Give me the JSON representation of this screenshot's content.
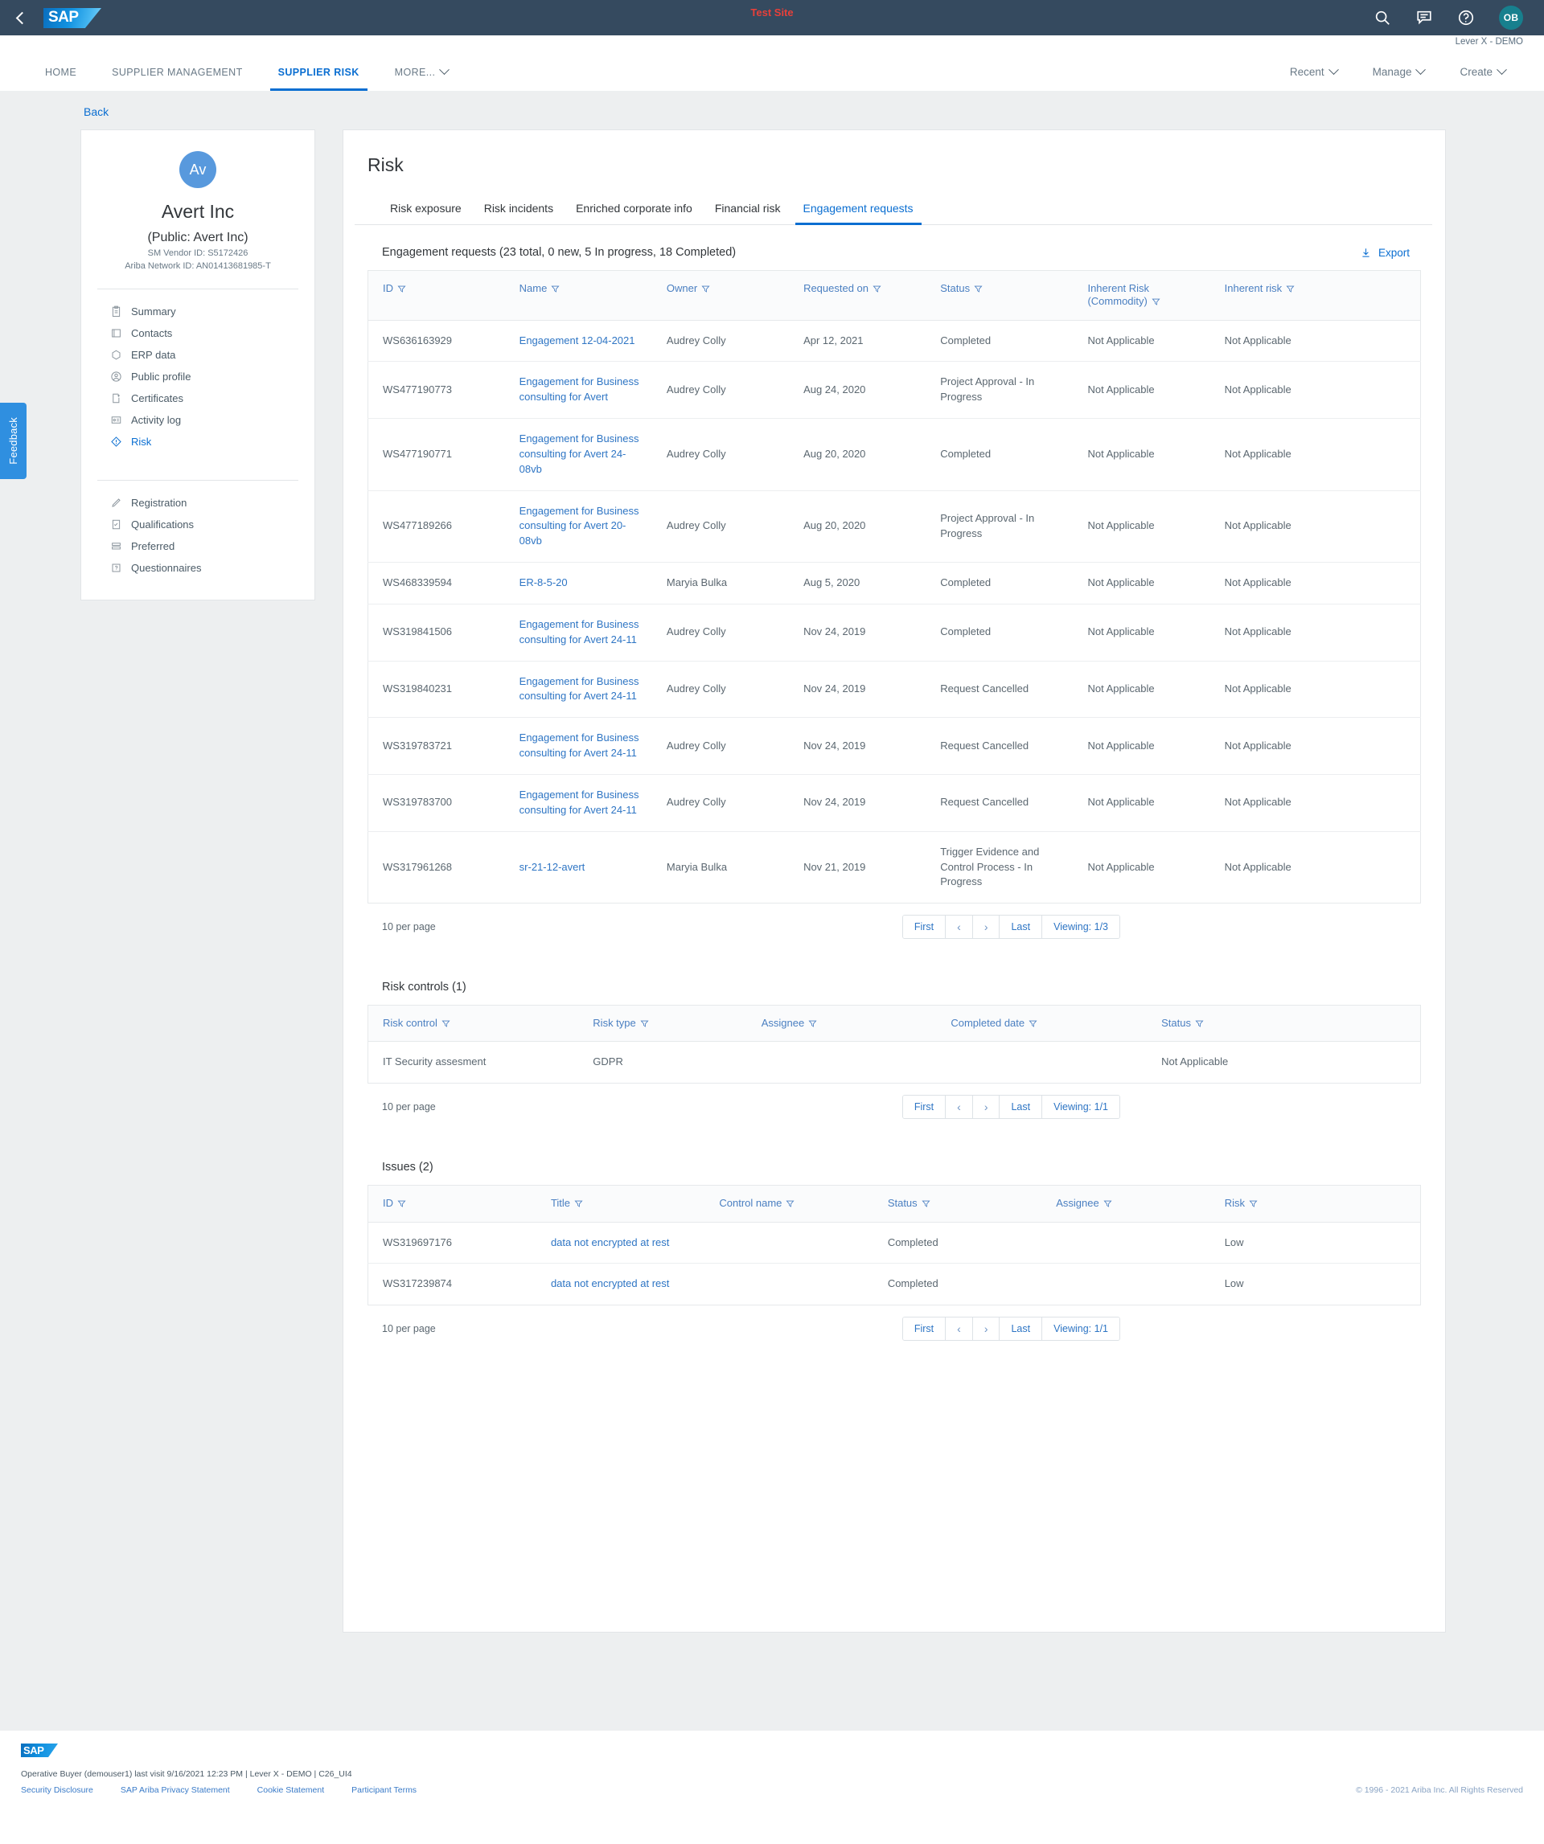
{
  "topbar": {
    "back_icon": "chevron-left-icon",
    "logo_text": "SAP",
    "test_site_label": "Test Site",
    "icons": [
      "search-icon",
      "message-icon",
      "help-icon"
    ],
    "avatar_initials": "OB",
    "tenant_label": "Lever X - DEMO"
  },
  "nav": {
    "items": [
      {
        "label": "HOME",
        "active": false
      },
      {
        "label": "SUPPLIER MANAGEMENT",
        "active": false
      },
      {
        "label": "SUPPLIER RISK",
        "active": true
      },
      {
        "label": "MORE...",
        "active": false,
        "caret": true
      }
    ],
    "right_items": [
      {
        "label": "Recent"
      },
      {
        "label": "Manage"
      },
      {
        "label": "Create"
      }
    ]
  },
  "back_link": "Back",
  "feedback_label": "Feedback",
  "supplier": {
    "avatar_initials": "Av",
    "name": "Avert Inc",
    "public_name": "(Public: Avert Inc)",
    "sm_vendor_id_label": "SM Vendor ID:",
    "sm_vendor_id_value": "S5172426",
    "ariba_network_id_label": "Ariba Network ID:",
    "ariba_network_id_value": "AN01413681985-T",
    "nav_primary": [
      {
        "label": "Summary",
        "icon": "clipboard-icon",
        "selected": false
      },
      {
        "label": "Contacts",
        "icon": "contact-card-icon",
        "selected": false
      },
      {
        "label": "ERP data",
        "icon": "database-icon",
        "selected": false
      },
      {
        "label": "Public profile",
        "icon": "user-circle-icon",
        "selected": false
      },
      {
        "label": "Certificates",
        "icon": "certificate-icon",
        "selected": false
      },
      {
        "label": "Activity log",
        "icon": "activity-log-icon",
        "selected": false
      },
      {
        "label": "Risk",
        "icon": "risk-diamond-icon",
        "selected": true
      }
    ],
    "nav_secondary": [
      {
        "label": "Registration",
        "icon": "pencil-icon",
        "selected": false
      },
      {
        "label": "Qualifications",
        "icon": "checklist-icon",
        "selected": false
      },
      {
        "label": "Preferred",
        "icon": "layers-icon",
        "selected": false
      },
      {
        "label": "Questionnaires",
        "icon": "question-box-icon",
        "selected": false
      }
    ]
  },
  "main": {
    "page_title": "Risk",
    "tabs": [
      {
        "label": "Risk exposure",
        "active": false
      },
      {
        "label": "Risk incidents",
        "active": false
      },
      {
        "label": "Enriched corporate info",
        "active": false
      },
      {
        "label": "Financial risk",
        "active": false
      },
      {
        "label": "Engagement requests",
        "active": true
      }
    ]
  },
  "engagement_requests": {
    "title": "Engagement requests (23 total, 0 new, 5 In progress, 18 Completed)",
    "export_label": "Export",
    "export_icon": "download-icon",
    "columns": [
      "ID",
      "Name",
      "Owner",
      "Requested on",
      "Status",
      "Inherent Risk (Commodity)",
      "Inherent risk"
    ],
    "rows": [
      {
        "id": "WS636163929",
        "name": "Engagement 12-04-2021",
        "owner": "Audrey Colly",
        "requested_on": "Apr 12, 2021",
        "status": "Completed",
        "inherent_commodity": "Not Applicable",
        "inherent_risk": "Not Applicable"
      },
      {
        "id": "WS477190773",
        "name": "Engagement for Business consulting for Avert",
        "owner": "Audrey Colly",
        "requested_on": "Aug 24, 2020",
        "status": "Project Approval - In Progress",
        "inherent_commodity": "Not Applicable",
        "inherent_risk": "Not Applicable"
      },
      {
        "id": "WS477190771",
        "name": "Engagement for Business consulting for Avert 24-08vb",
        "owner": "Audrey Colly",
        "requested_on": "Aug 20, 2020",
        "status": "Completed",
        "inherent_commodity": "Not Applicable",
        "inherent_risk": "Not Applicable"
      },
      {
        "id": "WS477189266",
        "name": "Engagement for Business consulting for Avert 20-08vb",
        "owner": "Audrey Colly",
        "requested_on": "Aug 20, 2020",
        "status": "Project Approval - In Progress",
        "inherent_commodity": "Not Applicable",
        "inherent_risk": "Not Applicable"
      },
      {
        "id": "WS468339594",
        "name": "ER-8-5-20",
        "owner": "Maryia Bulka",
        "requested_on": "Aug 5, 2020",
        "status": "Completed",
        "inherent_commodity": "Not Applicable",
        "inherent_risk": "Not Applicable"
      },
      {
        "id": "WS319841506",
        "name": "Engagement for Business consulting for Avert 24-11",
        "owner": "Audrey Colly",
        "requested_on": "Nov 24, 2019",
        "status": "Completed",
        "inherent_commodity": "Not Applicable",
        "inherent_risk": "Not Applicable"
      },
      {
        "id": "WS319840231",
        "name": "Engagement for Business consulting for Avert 24-11",
        "owner": "Audrey Colly",
        "requested_on": "Nov 24, 2019",
        "status": "Request Cancelled",
        "inherent_commodity": "Not Applicable",
        "inherent_risk": "Not Applicable"
      },
      {
        "id": "WS319783721",
        "name": "Engagement for Business consulting for Avert 24-11",
        "owner": "Audrey Colly",
        "requested_on": "Nov 24, 2019",
        "status": "Request Cancelled",
        "inherent_commodity": "Not Applicable",
        "inherent_risk": "Not Applicable"
      },
      {
        "id": "WS319783700",
        "name": "Engagement for Business consulting for Avert 24-11",
        "owner": "Audrey Colly",
        "requested_on": "Nov 24, 2019",
        "status": "Request Cancelled",
        "inherent_commodity": "Not Applicable",
        "inherent_risk": "Not Applicable"
      },
      {
        "id": "WS317961268",
        "name": "sr-21-12-avert",
        "owner": "Maryia Bulka",
        "requested_on": "Nov 21, 2019",
        "status": "Trigger Evidence and Control Process - In Progress",
        "inherent_commodity": "Not Applicable",
        "inherent_risk": "Not Applicable"
      }
    ],
    "pager": {
      "per_page": "10 per page",
      "first": "First",
      "prev": "‹",
      "next": "›",
      "last": "Last",
      "viewing": "Viewing: 1/3"
    }
  },
  "risk_controls": {
    "title": "Risk controls (1)",
    "columns": [
      "Risk control",
      "Risk type",
      "Assignee",
      "Completed date",
      "Status"
    ],
    "rows": [
      {
        "risk_control": "IT Security assesment",
        "risk_type": "GDPR",
        "assignee": "",
        "completed_date": "",
        "status": "Not Applicable"
      }
    ],
    "pager": {
      "per_page": "10 per page",
      "first": "First",
      "prev": "‹",
      "next": "›",
      "last": "Last",
      "viewing": "Viewing: 1/1"
    }
  },
  "issues": {
    "title": "Issues (2)",
    "columns": [
      "ID",
      "Title",
      "Control name",
      "Status",
      "Assignee",
      "Risk"
    ],
    "rows": [
      {
        "id": "WS319697176",
        "title": "data not encrypted at rest",
        "control_name": "",
        "status": "Completed",
        "assignee": "",
        "risk": "Low"
      },
      {
        "id": "WS317239874",
        "title": "data not encrypted at rest",
        "control_name": "",
        "status": "Completed",
        "assignee": "",
        "risk": "Low"
      }
    ],
    "pager": {
      "per_page": "10 per page",
      "first": "First",
      "prev": "‹",
      "next": "›",
      "last": "Last",
      "viewing": "Viewing: 1/1"
    }
  },
  "footer": {
    "logo_text": "SAP",
    "session_line": "Operative Buyer (demouser1) last visit 9/16/2021 12:23 PM | Lever X - DEMO | C26_UI4",
    "links": [
      "Security Disclosure",
      "SAP Ariba Privacy Statement",
      "Cookie Statement",
      "Participant Terms"
    ],
    "copyright": "© 1996 - 2021 Ariba Inc. All Rights Reserved"
  },
  "colors": {
    "header_bg": "#354a5f",
    "accent": "#0a6ed1",
    "link": "#2e75c4",
    "test_site": "#e8403a",
    "avatar_ob": "#17808e",
    "avatar_supplier": "#5899dd",
    "feedback": "#2f8fe0",
    "page_bg": "#edeff0"
  }
}
